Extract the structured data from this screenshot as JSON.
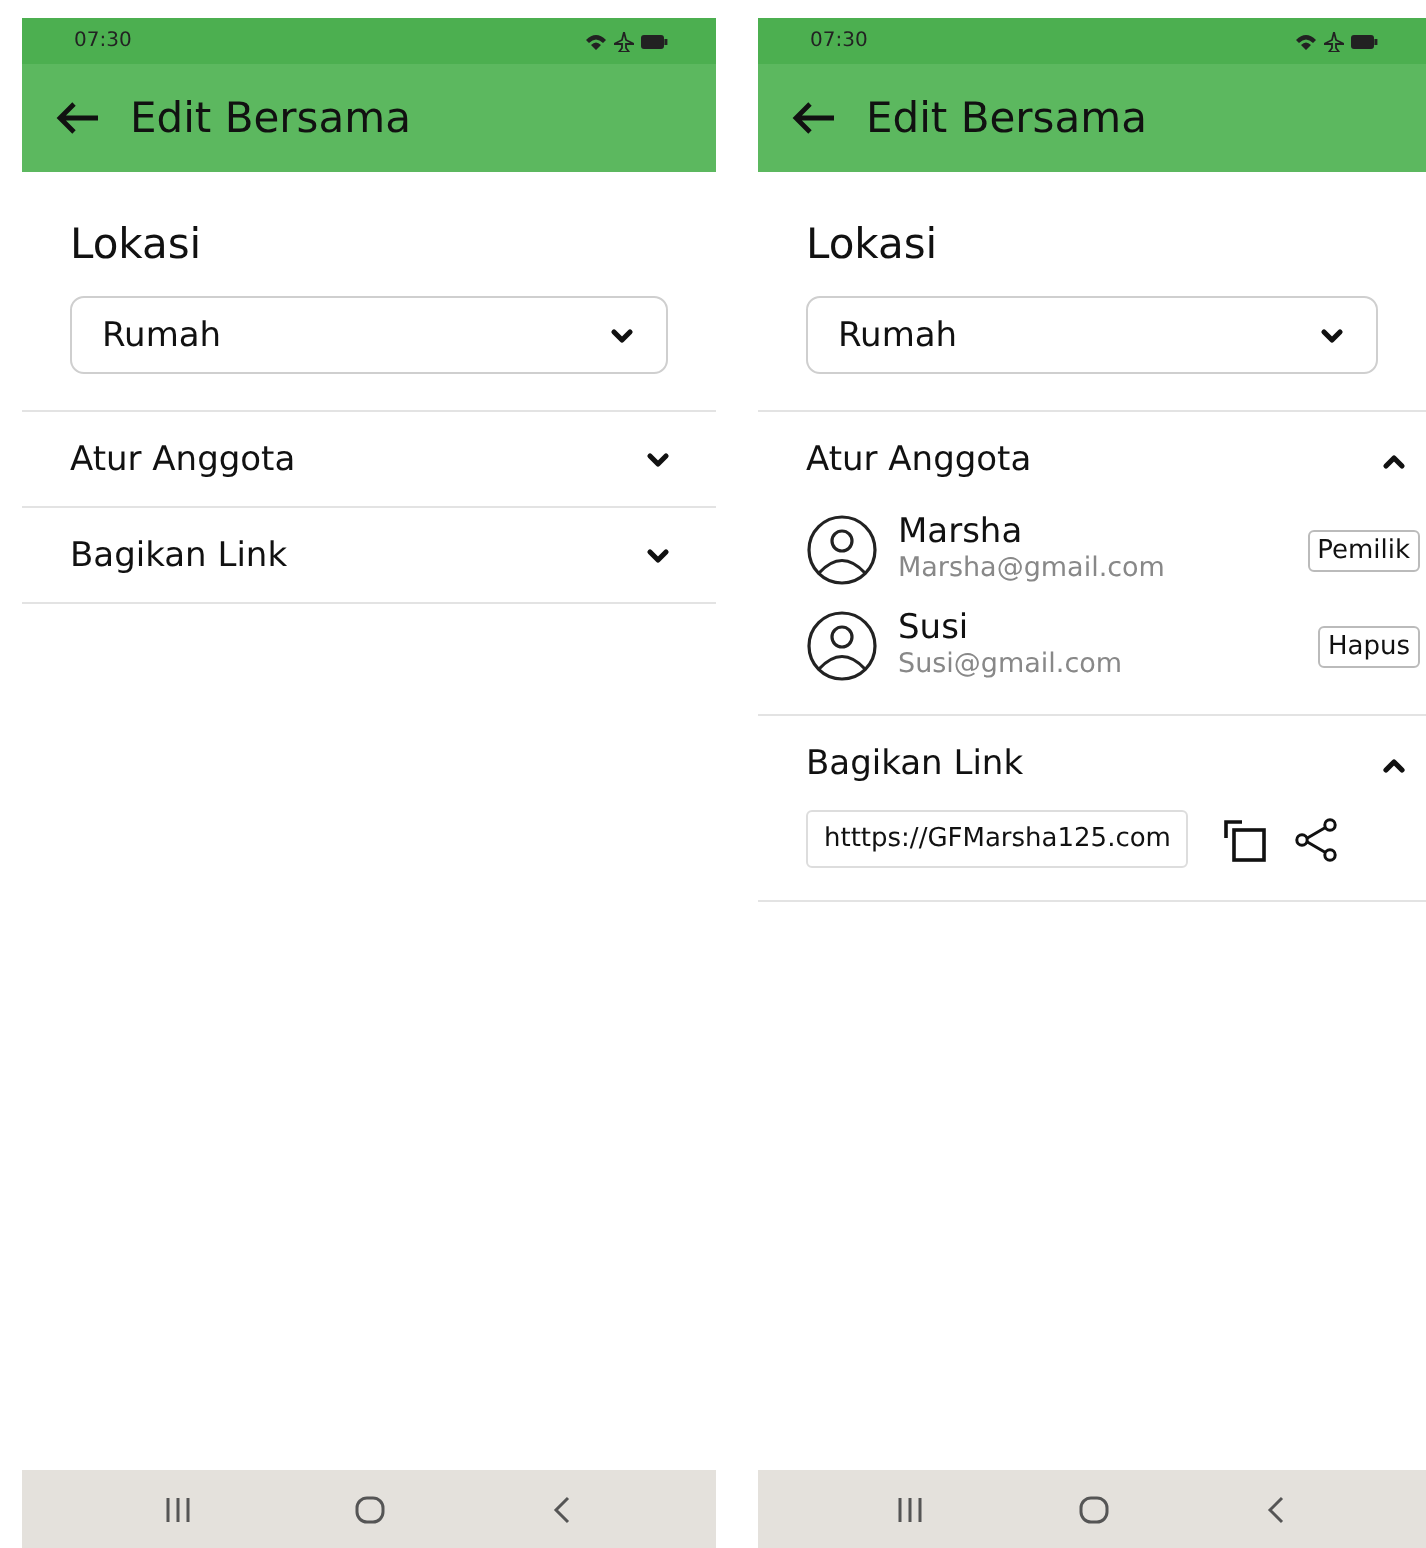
{
  "screens": [
    {
      "status_bar": {
        "time": "07:30"
      },
      "app_bar": {
        "title": "Edit Bersama"
      },
      "location": {
        "label": "Lokasi",
        "value": "Rumah"
      },
      "sections": [
        {
          "title": "Atur Anggota",
          "expanded": false
        },
        {
          "title": "Bagikan Link",
          "expanded": false
        }
      ]
    },
    {
      "status_bar": {
        "time": "07:30"
      },
      "app_bar": {
        "title": "Edit Bersama"
      },
      "location": {
        "label": "Lokasi",
        "value": "Rumah"
      },
      "sections": [
        {
          "title": "Atur Anggota",
          "expanded": true,
          "members": [
            {
              "name": "Marsha",
              "email": "Marsha@gmail.com",
              "action": "Pemilik"
            },
            {
              "name": "Susi",
              "email": "Susi@gmail.com",
              "action": "Hapus"
            }
          ]
        },
        {
          "title": "Bagikan Link",
          "expanded": true,
          "link": "htttps://GFMarsha125.com"
        }
      ]
    }
  ]
}
